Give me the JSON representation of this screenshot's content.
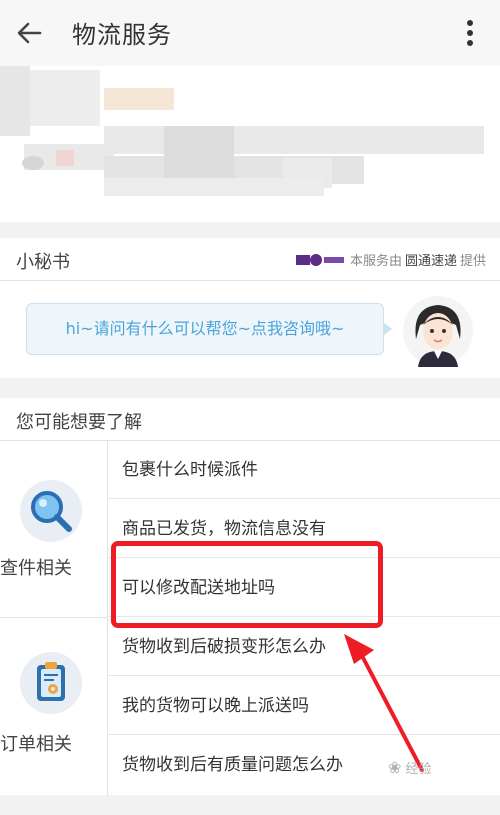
{
  "header": {
    "title": "物流服务",
    "back_icon": "arrow-left-icon",
    "more_icon": "vertical-dots-icon"
  },
  "secretary": {
    "title": "小秘书",
    "provider_prefix": "本服务由",
    "provider_name": "圆通速递",
    "provider_suffix": "提供",
    "bubble_text": "hi~请问有什么可以帮您~点我咨询哦~",
    "bubble_color": "#4aa3da"
  },
  "faq": {
    "title": "您可能想要了解",
    "categories": [
      {
        "label": "查件相关",
        "icon": "magnifier-icon",
        "questions": [
          "包裹什么时候派件",
          "商品已发货，物流信息没有",
          "可以修改配送地址吗"
        ]
      },
      {
        "label": "订单相关",
        "icon": "clipboard-gear-icon",
        "questions": [
          "货物收到后破损变形怎么办",
          "我的货物可以晚上派送吗",
          "货物收到后有质量问题怎么办"
        ]
      }
    ]
  },
  "annotation": {
    "highlight_color": "#ee1c25"
  },
  "watermark": {
    "text": "经验"
  }
}
